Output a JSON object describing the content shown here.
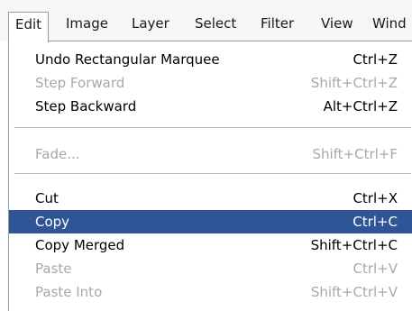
{
  "menubar": {
    "items": [
      {
        "label": "Edit"
      },
      {
        "label": "Image"
      },
      {
        "label": "Layer"
      },
      {
        "label": "Select"
      },
      {
        "label": "Filter"
      },
      {
        "label": "View"
      },
      {
        "label": "Wind"
      }
    ]
  },
  "edit_menu": {
    "items": [
      {
        "label": "Undo Rectangular Marquee",
        "shortcut": "Ctrl+Z",
        "enabled": true
      },
      {
        "label": "Step Forward",
        "shortcut": "Shift+Ctrl+Z",
        "enabled": false
      },
      {
        "label": "Step Backward",
        "shortcut": "Alt+Ctrl+Z",
        "enabled": true
      },
      {
        "label": "Fade...",
        "shortcut": "Shift+Ctrl+F",
        "enabled": false
      },
      {
        "label": "Cut",
        "shortcut": "Ctrl+X",
        "enabled": true
      },
      {
        "label": "Copy",
        "shortcut": "Ctrl+C",
        "enabled": true,
        "highlighted": true
      },
      {
        "label": "Copy Merged",
        "shortcut": "Shift+Ctrl+C",
        "enabled": true
      },
      {
        "label": "Paste",
        "shortcut": "Ctrl+V",
        "enabled": false
      },
      {
        "label": "Paste Into",
        "shortcut": "Shift+Ctrl+V",
        "enabled": false
      }
    ]
  },
  "colors": {
    "highlight": "#2f5597",
    "disabled_text": "#a8a8a8",
    "menubar_bg": "#f6f6f6"
  }
}
